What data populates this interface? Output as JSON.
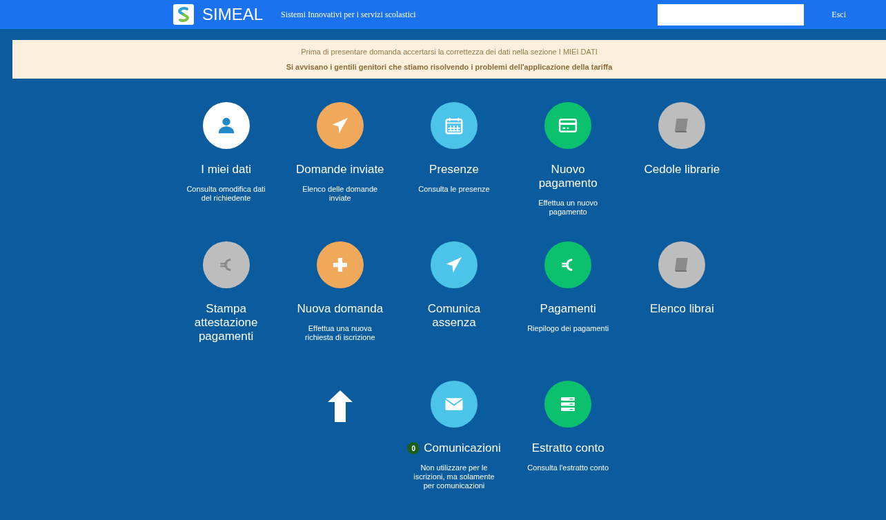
{
  "header": {
    "brand": "SIMEAL",
    "tagline": "Sistemi Innovativi per i servizi scolastici",
    "logout": "Esci"
  },
  "notice": {
    "lines": [
      {
        "text": "Prima di presentare domanda accertarsi la correttezza dei dati nella sezione I MIEI DATI",
        "bold": false
      },
      {
        "text": "Si avvisano i gentili genitori che stiamo risolvendo i problemi dell'applicazione della tariffa",
        "bold": true
      }
    ]
  },
  "menu": {
    "rows": [
      [
        {
          "kind": "tile",
          "color": "#ffffff",
          "title": "I miei dati",
          "description": "Consulta omodifica dati del richiedente"
        },
        {
          "kind": "tile",
          "color": "#f0a85a",
          "title": "Domande inviate",
          "description": "Elenco delle domande inviate"
        },
        {
          "kind": "tile",
          "color": "#4cc3e8",
          "title": "Presenze",
          "description": "Consulta le presenze"
        },
        {
          "kind": "tile",
          "color": "#0cc16e",
          "title": "Nuovo pagamento",
          "description": "Effettua un nuovo pagamento"
        },
        {
          "kind": "tile",
          "color": "#bdbdbd",
          "title": "Cedole librarie"
        }
      ],
      [
        {
          "kind": "tile",
          "color": "#bdbdbd",
          "title": "Stampa attestazione pagamenti"
        },
        {
          "kind": "tile",
          "color": "#f0a85a",
          "title": "Nuova domanda",
          "description": "Effettua una nuova richiesta di iscrizione"
        },
        {
          "kind": "tile",
          "color": "#4cc3e8",
          "title": "Comunica assenza"
        },
        {
          "kind": "tile",
          "color": "#0cc16e",
          "title": "Pagamenti",
          "description": "Riepilogo dei pagamenti"
        },
        {
          "kind": "tile",
          "color": "#bdbdbd",
          "title": "Elenco librai"
        }
      ],
      [
        {
          "kind": "blank"
        },
        {
          "kind": "arrow"
        },
        {
          "kind": "tile",
          "color": "#4cc3e8",
          "title": "Comunicazioni",
          "badge": "0",
          "description": "Non utilizzare per le iscrizioni, ma solamente per comunicazioni"
        },
        {
          "kind": "tile",
          "color": "#0cc16e",
          "title": "Estratto conto",
          "description": "Consulta l'estratto conto"
        }
      ]
    ]
  }
}
